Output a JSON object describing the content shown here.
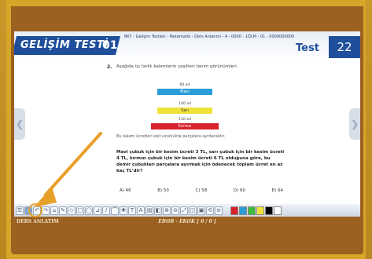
{
  "header": {
    "brand_title": "GELİŞİM TESTİ",
    "brand_suffix": "01",
    "info_line": "BKY - Gelişim Testleri - Matematik - Ders Anlatımı - 4 - 0000 - 1ÖLM - 01 - 0000000000",
    "test_label": "Test",
    "page_number": "22"
  },
  "navigation": {
    "prev_symbol": "❮",
    "next_symbol": "❯"
  },
  "question": {
    "number": "2.",
    "text": "Aşağıda üç farklı kalemlerin çeşitleri tanım görünümleri.",
    "labels": [
      "80 ad",
      "100 ad",
      "110 ad"
    ],
    "bars": [
      "Mavi",
      "Sarı",
      "Kırmızı"
    ],
    "sub_question": "Bu kalem ücretleri eşit uzunlukta parçalara ayrılacaktır.",
    "body": "Mavi çubuk için bir kesim ücreti 3 TL, sarı çubuk için bir kesim ücreti 4 TL, kırmızı çubuk için bir kesim ücreti 6 TL olduğuna göre, bu demir çubukları parçalara ayırmak için ödenecek toplam ücret en az kaç TL'dir?",
    "options": [
      "A) 46",
      "B) 50",
      "C) 58",
      "D) 60",
      "E) 64"
    ]
  },
  "toolbar": {
    "buttons": [
      "☰",
      "◯",
      "↶",
      "↷",
      "⌂",
      "✎",
      "◇",
      "□",
      "◯",
      "⊿",
      "∕",
      "⌒",
      "✚",
      "T",
      "A",
      "▤",
      "◧",
      "⊕",
      "⊖",
      "⤢",
      "◫",
      "▣",
      "⟲",
      "≡"
    ],
    "selected_index": 1,
    "swatch_colors": [
      "#d8222e",
      "#2a9ed8",
      "#3dbb3d",
      "#f0e23a",
      "#000000",
      "#ffffff"
    ]
  },
  "status": {
    "left_text": "DERS ANLATIM",
    "center_text": "EBOB - EKOK  [ 0 / 0 ]"
  },
  "colors": {
    "frame": "#d7a527",
    "panel": "#9a6121",
    "brand_blue": "#1f4f9a",
    "pointer_orange": "#e8a02a"
  }
}
